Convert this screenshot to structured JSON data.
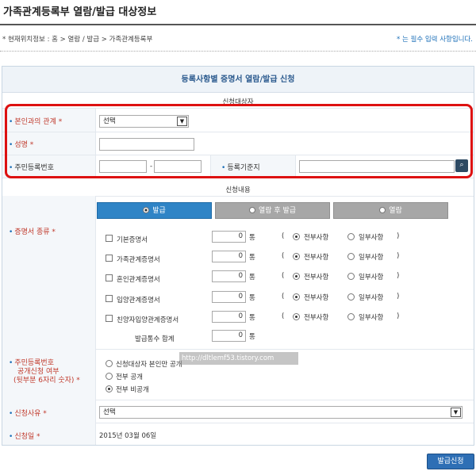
{
  "page": {
    "title": "가족관계등록부 열람/발급 대상정보",
    "location": "* 현재위치정보 : 홈 > 열람 / 발급 > 가족관계등록부",
    "required_note": "* 는 필수 입력 사항입니다."
  },
  "form": {
    "heading": "등록사항별 증명서 열람/발급 신청",
    "target_section": "신청대상자",
    "relation_label": "본인과의 관계 *",
    "relation_value": "선택",
    "name_label": "성명 *",
    "rrn_label": "주민등록번호",
    "rrn_separator": "-",
    "reg_base_label": "등록기준지",
    "content_section": "신청내용",
    "tabs": [
      {
        "label": "발급",
        "active": true
      },
      {
        "label": "열람 후 발급",
        "active": false
      },
      {
        "label": "열람",
        "active": false
      }
    ],
    "cert_type_label": "증명서 종류 *",
    "certificates": [
      {
        "name": "기본증명서",
        "count": "0",
        "unit": "통",
        "open": "(",
        "opt_all": "전부사항",
        "opt_part": "일부사항",
        "close": ")"
      },
      {
        "name": "가족관계증명서",
        "count": "0",
        "unit": "통",
        "open": "(",
        "opt_all": "전부사항",
        "opt_part": "일부사항",
        "close": ")"
      },
      {
        "name": "혼인관계증명서",
        "count": "0",
        "unit": "통",
        "open": "(",
        "opt_all": "전부사항",
        "opt_part": "일부사항",
        "close": ")"
      },
      {
        "name": "입양관계증명서",
        "count": "0",
        "unit": "통",
        "open": "(",
        "opt_all": "전부사항",
        "opt_part": "일부사항",
        "close": ")"
      },
      {
        "name": "친양자입양관계증명서",
        "count": "0",
        "unit": "통",
        "open": "(",
        "opt_all": "전부사항",
        "opt_part": "일부사항",
        "close": ")"
      }
    ],
    "total_label": "발급통수 합계",
    "total_count": "0",
    "total_unit": "통",
    "disclosure_label_1": "주민등록번호",
    "disclosure_label_2": "공개신청 여부",
    "disclosure_label_3": "(뒷부분 6자리 숫자) *",
    "disclosure_options": [
      {
        "label": "신청대상자 본인만 공개",
        "checked": false
      },
      {
        "label": "전부 공개",
        "checked": false
      },
      {
        "label": "전부 비공개",
        "checked": true
      }
    ],
    "reason_label": "신청사유 *",
    "reason_value": "선택",
    "date_label": "신청일 *",
    "date_value": "2015년 03월 06일",
    "watermark": "http://dltlemf53.tistory.com",
    "submit_label": "발급신청"
  },
  "colors": {
    "accent": "#2f84c6",
    "highlight": "#dd1111",
    "required": "#c0392b"
  }
}
